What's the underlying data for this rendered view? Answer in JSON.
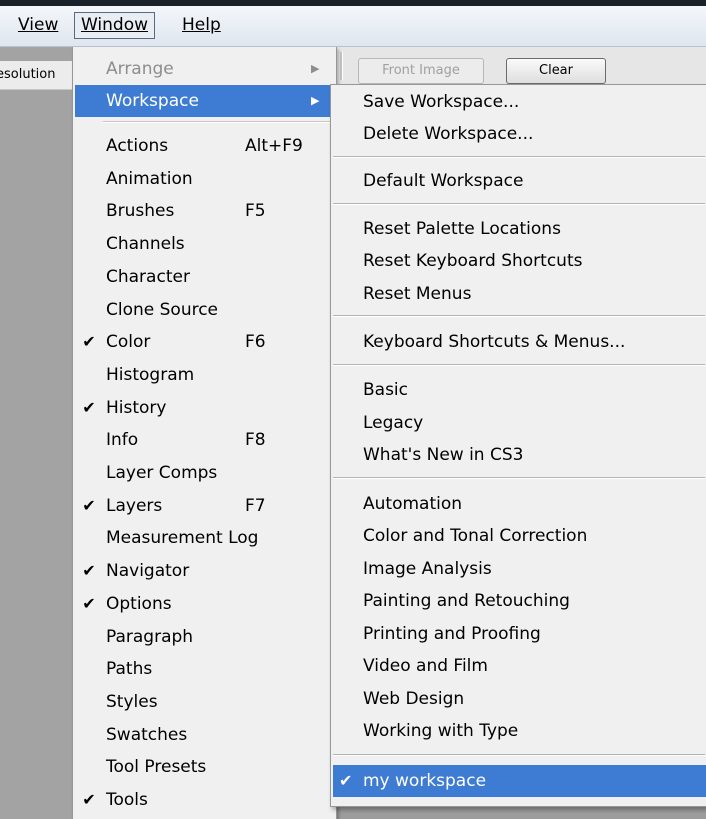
{
  "menubar": {
    "view": "View",
    "window": "Window",
    "help": "Help"
  },
  "app": {
    "resolution_label": "esolution",
    "front_image_button": "Front Image",
    "clear_button": "Clear"
  },
  "window_menu": {
    "arrange": "Arrange",
    "workspace": "Workspace",
    "items": [
      {
        "label": "Actions",
        "shortcut": "Alt+F9",
        "checked": ""
      },
      {
        "label": "Animation",
        "shortcut": "",
        "checked": ""
      },
      {
        "label": "Brushes",
        "shortcut": "F5",
        "checked": ""
      },
      {
        "label": "Channels",
        "shortcut": "",
        "checked": ""
      },
      {
        "label": "Character",
        "shortcut": "",
        "checked": ""
      },
      {
        "label": "Clone Source",
        "shortcut": "",
        "checked": ""
      },
      {
        "label": "Color",
        "shortcut": "F6",
        "checked": "✔"
      },
      {
        "label": "Histogram",
        "shortcut": "",
        "checked": ""
      },
      {
        "label": "History",
        "shortcut": "",
        "checked": "✔"
      },
      {
        "label": "Info",
        "shortcut": "F8",
        "checked": ""
      },
      {
        "label": "Layer Comps",
        "shortcut": "",
        "checked": ""
      },
      {
        "label": "Layers",
        "shortcut": "F7",
        "checked": "✔"
      },
      {
        "label": "Measurement Log",
        "shortcut": "",
        "checked": ""
      },
      {
        "label": "Navigator",
        "shortcut": "",
        "checked": "✔"
      },
      {
        "label": "Options",
        "shortcut": "",
        "checked": "✔"
      },
      {
        "label": "Paragraph",
        "shortcut": "",
        "checked": ""
      },
      {
        "label": "Paths",
        "shortcut": "",
        "checked": ""
      },
      {
        "label": "Styles",
        "shortcut": "",
        "checked": ""
      },
      {
        "label": "Swatches",
        "shortcut": "",
        "checked": ""
      },
      {
        "label": "Tool Presets",
        "shortcut": "",
        "checked": ""
      },
      {
        "label": "Tools",
        "shortcut": "",
        "checked": "✔"
      }
    ]
  },
  "workspace_menu": {
    "save": "Save Workspace...",
    "delete": "Delete Workspace...",
    "default": "Default Workspace",
    "reset_palette": "Reset Palette Locations",
    "reset_keyboard": "Reset Keyboard Shortcuts",
    "reset_menus": "Reset Menus",
    "keyboard_menus": "Keyboard Shortcuts & Menus...",
    "basic": "Basic",
    "legacy": "Legacy",
    "whats_new": "What's New in CS3",
    "automation": "Automation",
    "color_tonal": "Color and Tonal Correction",
    "image_analysis": "Image Analysis",
    "painting": "Painting and Retouching",
    "printing": "Printing and Proofing",
    "video_film": "Video and Film",
    "web_design": "Web Design",
    "working_type": "Working with Type",
    "my_workspace": "my workspace",
    "my_workspace_check": "✔"
  },
  "icons": {
    "check": "checkmark-icon",
    "submenu_arrow": "submenu-arrow-icon"
  },
  "colors": {
    "highlight": "#3e7bd3",
    "menu_bg": "#f0f0f0",
    "disabled": "#8d8d8d"
  }
}
